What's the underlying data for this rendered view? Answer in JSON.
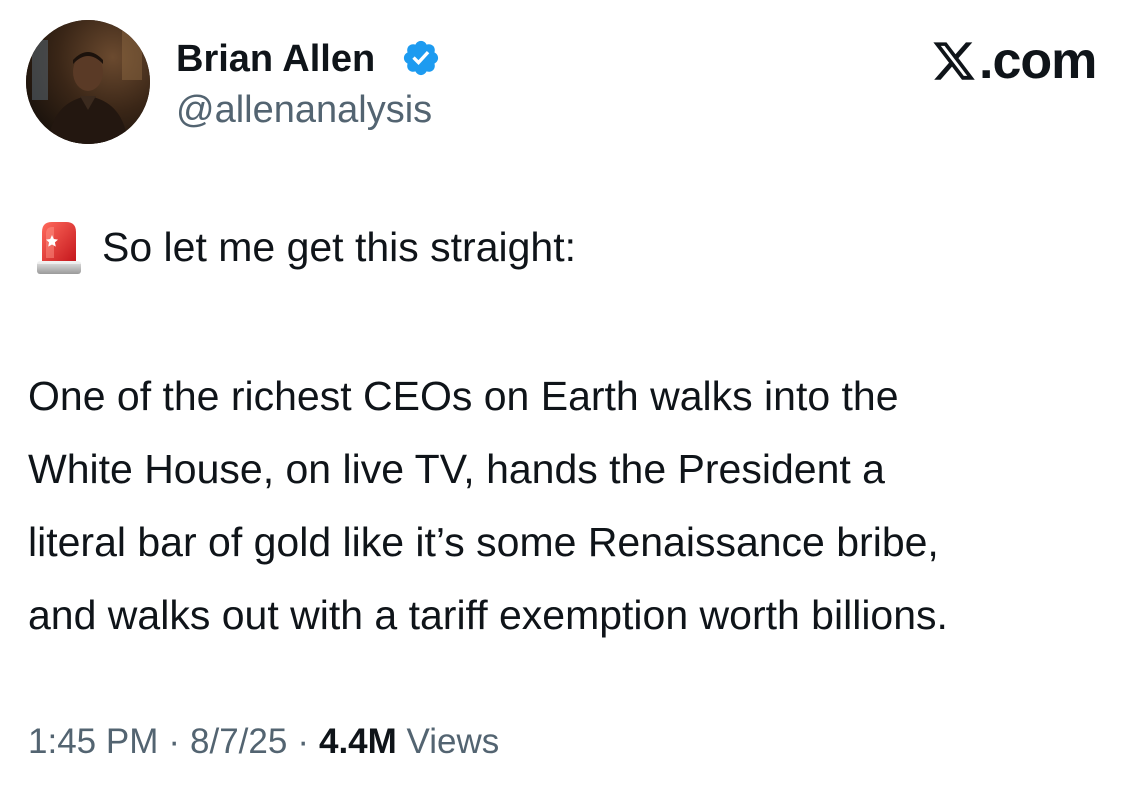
{
  "author": {
    "display_name": "Brian Allen",
    "handle": "@allenanalysis",
    "verified_icon": "verified-badge-icon",
    "avatar_icon": "profile-photo"
  },
  "brand": {
    "icon": "x-logo-icon",
    "label": ".com"
  },
  "tweet": {
    "lead_icon": "police-siren-emoji",
    "intro": "So let me get this straight:",
    "body_lines": [
      "One of the richest CEOs on Earth walks into the",
      "White House, on live TV, hands the President a",
      "literal bar of gold like it’s some Renaissance bribe,",
      "and walks out with a tariff exemption worth billions."
    ]
  },
  "meta": {
    "time": "1:45 PM",
    "separator": "·",
    "date": "8/7/25",
    "views_count": "4.4M",
    "views_label": "Views"
  },
  "colors": {
    "text_primary": "#0f1419",
    "text_secondary": "#536471",
    "verified_blue": "#1d9bf0",
    "siren_red": "#e0302a"
  }
}
